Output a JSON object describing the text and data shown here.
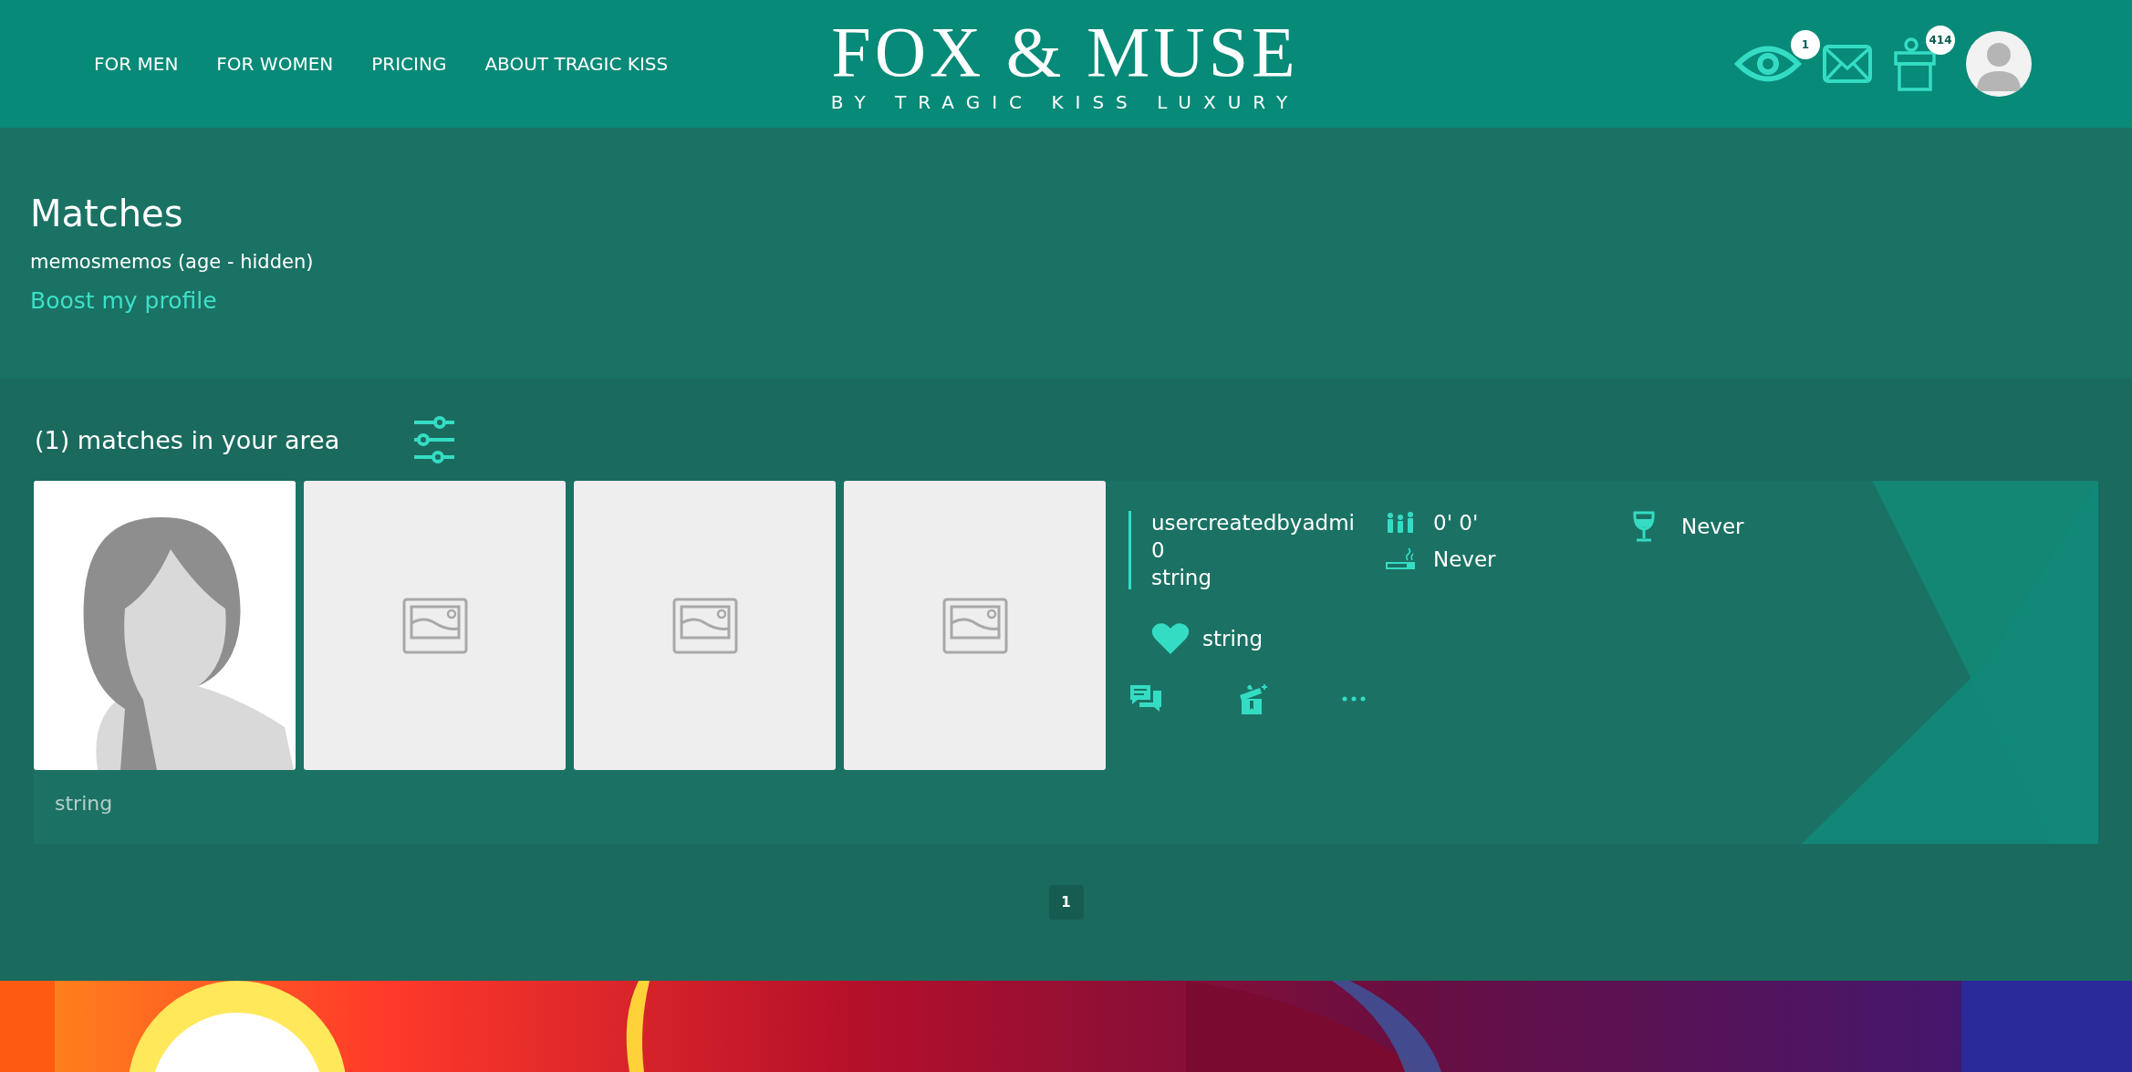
{
  "nav": {
    "links": [
      "FOR MEN",
      "FOR WOMEN",
      "PRICING",
      "ABOUT TRAGIC KISS"
    ]
  },
  "logo": {
    "title": "FOX & MUSE",
    "tagline": "BY TRAGIC KISS LUXURY"
  },
  "header_icons": [
    {
      "kind": "views",
      "badge": "1"
    },
    {
      "kind": "messages"
    },
    {
      "kind": "gifts",
      "badge": "414"
    },
    {
      "kind": "avatar"
    }
  ],
  "profile": {
    "title": "Matches",
    "subtitle": "memosmemos (age - hidden)",
    "boost_link": "Boost my profile"
  },
  "results": {
    "heading": "(1) matches in your area"
  },
  "matches": [
    {
      "photos": [
        {
          "kind": "silhouette"
        },
        {
          "kind": "placeholder"
        },
        {
          "kind": "placeholder"
        },
        {
          "kind": "placeholder"
        }
      ],
      "caption": "string",
      "name": "usercreatedbyadmi",
      "age": "0",
      "location": "string",
      "height": "0' 0'",
      "smoking": "Never",
      "drinking": "Never",
      "interest": "string"
    }
  ],
  "pagination": [
    {
      "label": "1",
      "selected": true
    }
  ]
}
